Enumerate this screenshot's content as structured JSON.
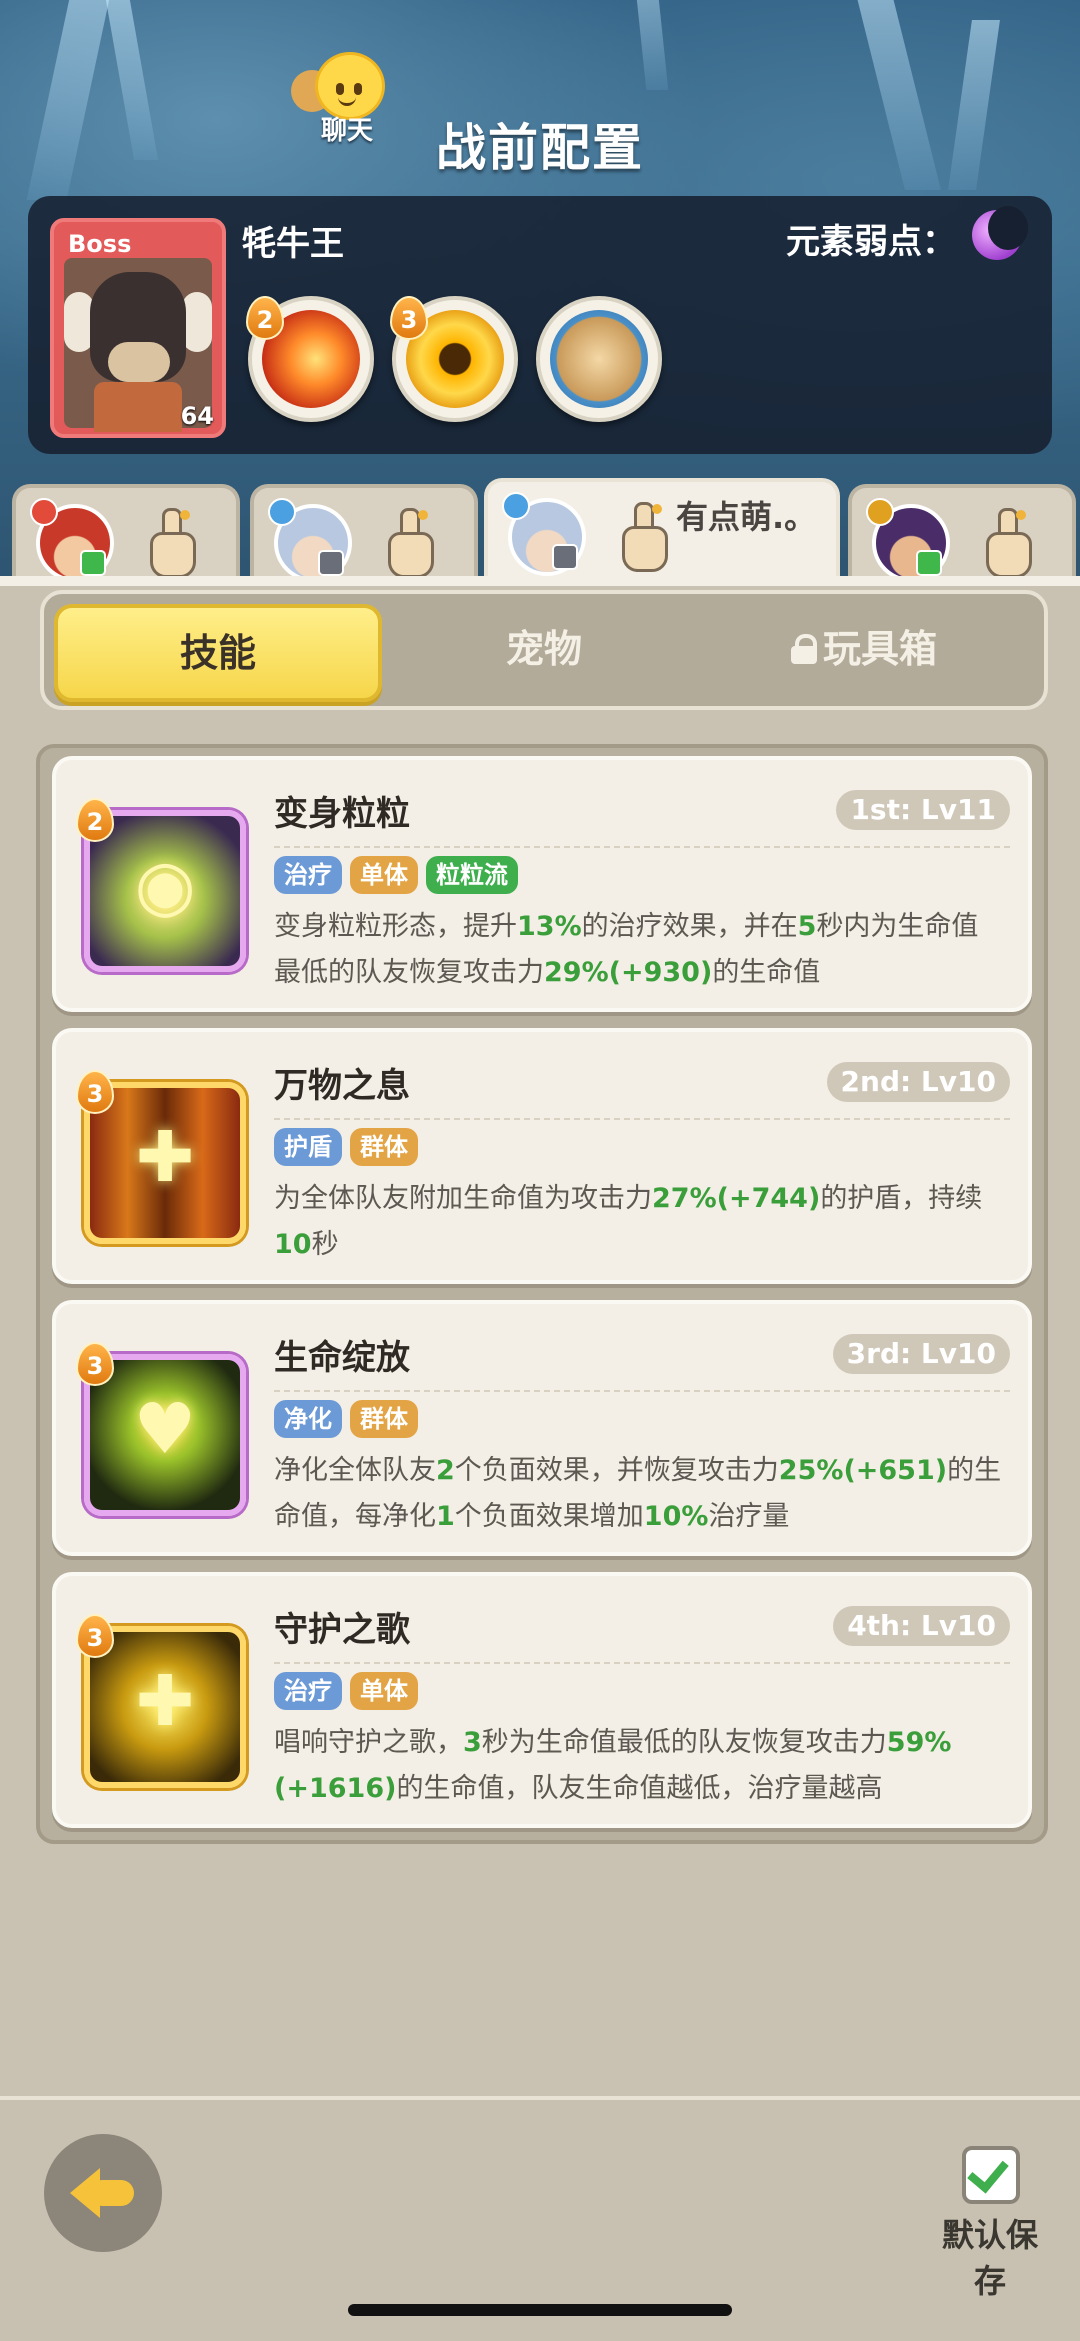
{
  "header": {
    "title": "战前配置",
    "chat_label": "聊天"
  },
  "boss": {
    "tag": "Boss",
    "name": "牦牛王",
    "level": "64",
    "weakness_label": "元素弱点：",
    "weakness_icon": "moon-icon",
    "skills": [
      {
        "icon": "fire-burst-icon",
        "badge": "2"
      },
      {
        "icon": "golden-ring-icon",
        "badge": "3"
      },
      {
        "icon": "rock-shield-icon",
        "badge": ""
      }
    ]
  },
  "team_tabs": [
    {
      "avatar": "red-hair-hero",
      "element": "fire",
      "active": false,
      "name": ""
    },
    {
      "avatar": "silver-hair-hero",
      "element": "water",
      "active": false,
      "name": ""
    },
    {
      "avatar": "silver-hair-hero",
      "element": "water",
      "active": true,
      "name": "有点萌.。"
    },
    {
      "avatar": "purple-hair-hero",
      "element": "thunder",
      "active": false,
      "name": ""
    }
  ],
  "tabs": {
    "skills": "技能",
    "pets": "宠物",
    "toybox": "玩具箱",
    "active": "skills"
  },
  "skills": [
    {
      "badge": "2",
      "name": "变身粒粒",
      "level": "1st: Lv11",
      "tags": [
        "治疗",
        "单体",
        "粒粒流"
      ],
      "description": "变身粒粒形态，提升13%的治疗效果，并在5秒内为生命值最低的队友恢复攻击力29%(+930)的生命值"
    },
    {
      "badge": "3",
      "name": "万物之息",
      "level": "2nd: Lv10",
      "tags": [
        "护盾",
        "群体"
      ],
      "description": "为全体队友附加生命值为攻击力27%(+744)的护盾，持续10秒"
    },
    {
      "badge": "3",
      "name": "生命绽放",
      "level": "3rd: Lv10",
      "tags": [
        "净化",
        "群体"
      ],
      "description": "净化全体队友2个负面效果，并恢复攻击力25%(+651)的生命值，每净化1个负面效果增加10%治疗量"
    },
    {
      "badge": "3",
      "name": "守护之歌",
      "level": "4th: Lv10",
      "tags": [
        "治疗",
        "单体"
      ],
      "description": "唱响守护之歌，3秒为生命值最低的队友恢复攻击力59%(+1616)的生命值，队友生命值越低，治疗量越高"
    }
  ],
  "footer": {
    "save_label": "默认保存",
    "save_checked": true
  },
  "colors": {
    "tag_blue": "#6c9ad6",
    "tag_orange": "#e3a445",
    "tag_green": "#3fae4d",
    "highlight": "#3a9e3a",
    "active_tab": "#f6d64a"
  }
}
